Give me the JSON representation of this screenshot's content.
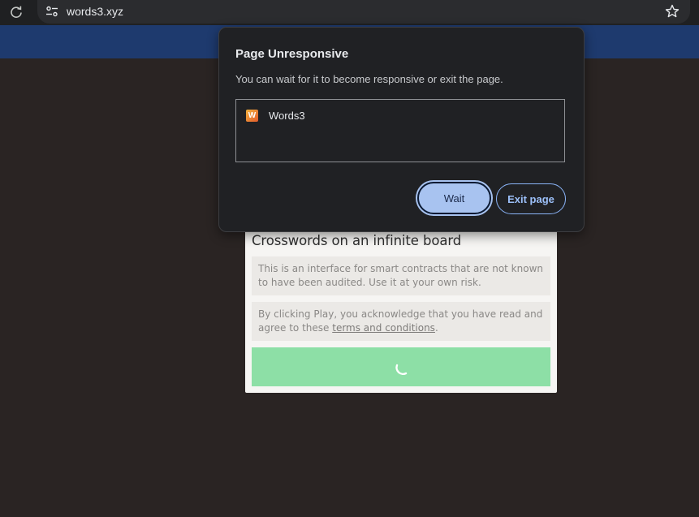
{
  "browser": {
    "url": "words3.xyz",
    "icons": {
      "reload": "reload-icon",
      "site_info": "site-info-icon",
      "bookmark": "bookmark-star-icon"
    }
  },
  "page": {
    "title": "Crosswords on an infinite board",
    "notice_1": "This is an interface for smart contracts that are not known to have been audited. Use it at your own risk.",
    "notice_2_prefix": "By clicking Play, you acknowledge that you have read and agree to these ",
    "notice_2_link": "terms and conditions",
    "notice_2_suffix": ".",
    "play_button_state": "loading"
  },
  "dialog": {
    "title": "Page Unresponsive",
    "message": "You can wait for it to become responsive or exit the page.",
    "pages": [
      {
        "favicon_letter": "W",
        "label": "Words3"
      }
    ],
    "wait_label": "Wait",
    "exit_label": "Exit page"
  },
  "colors": {
    "page_background": "#2a2423",
    "header": "#1e3a6e",
    "dialog_background": "#202124",
    "wait_button": "#a8c3f0",
    "exit_button_text": "#9cc0f9",
    "play_button": "#8ddfa6"
  }
}
